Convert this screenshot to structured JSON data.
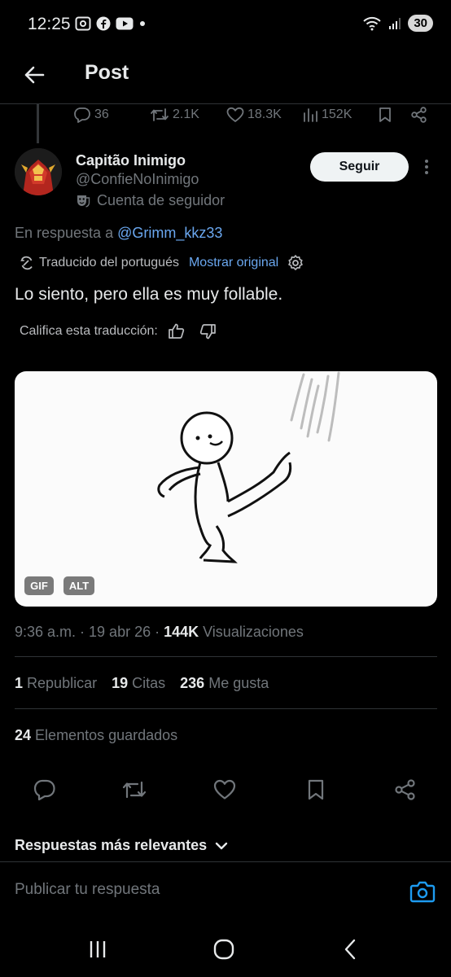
{
  "status_bar": {
    "time": "12:25",
    "battery": "30",
    "icons": [
      "screenshot-icon",
      "facebook-icon",
      "youtube-icon",
      "dot-icon",
      "wifi-icon",
      "signal-icon"
    ]
  },
  "header": {
    "title": "Post",
    "back_icon": "arrow-left-icon"
  },
  "parent_post_actions": {
    "replies": "36",
    "reposts": "2.1K",
    "likes": "18.3K",
    "views": "152K"
  },
  "author": {
    "name": "Capitão Inimigo",
    "handle": "@ConfieNoInimigo",
    "badge": "Cuenta de seguidor",
    "follow_label": "Seguir"
  },
  "reply_to": {
    "prefix": "En respuesta a ",
    "handle": "@Grimm_kkz33"
  },
  "translation": {
    "label": "Traducido del portugués",
    "show_original": "Mostrar original",
    "rate_label": "Califica esta traducción:"
  },
  "post": {
    "text": "Lo siento, pero ella es muy follable."
  },
  "media": {
    "tags": [
      "GIF",
      "ALT"
    ]
  },
  "meta": {
    "time_date": "9:36 a.m. · 19 abr 26 · ",
    "views_count": "144K",
    "views_label": " Visualizaciones"
  },
  "stats": {
    "reposts_count": "1",
    "reposts_label": "Republicar",
    "quotes_count": "19",
    "quotes_label": "Citas",
    "likes_count": "236",
    "likes_label": "Me gusta",
    "bookmarks_count": "24",
    "bookmarks_label": "Elementos guardados"
  },
  "replies": {
    "sort_label": "Respuestas más relevantes",
    "input_placeholder": "Publicar tu respuesta"
  },
  "colors": {
    "background": "#000000",
    "text": "#e7e9ea",
    "secondary": "#71767b",
    "link": "#6aa7ef",
    "camera": "#1d9bf0"
  }
}
